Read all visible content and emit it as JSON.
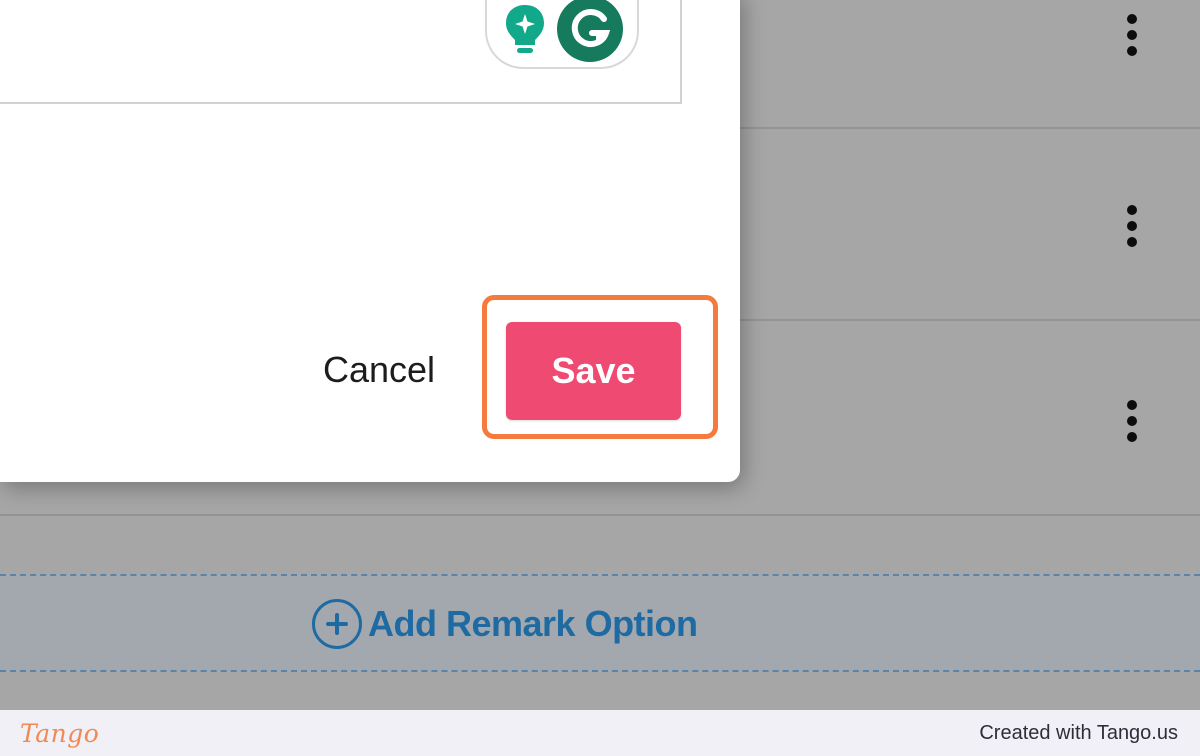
{
  "dialog": {
    "cancel_label": "Cancel",
    "save_label": "Save"
  },
  "list": {
    "add_remark_label": "Add Remark Option"
  },
  "icons": {
    "row_menu": "kebab-menu-icon",
    "bulb": "lightbulb-sparkle-icon",
    "grammarly": "grammarly-icon",
    "add": "plus-circle-icon"
  },
  "colors": {
    "save_button": "#ef4a72",
    "highlight": "#f47a3e",
    "grammarly": "#167a5d",
    "link": "#1e6aa3"
  },
  "footer": {
    "brand": "Tango",
    "credit": "Created with Tango.us"
  }
}
